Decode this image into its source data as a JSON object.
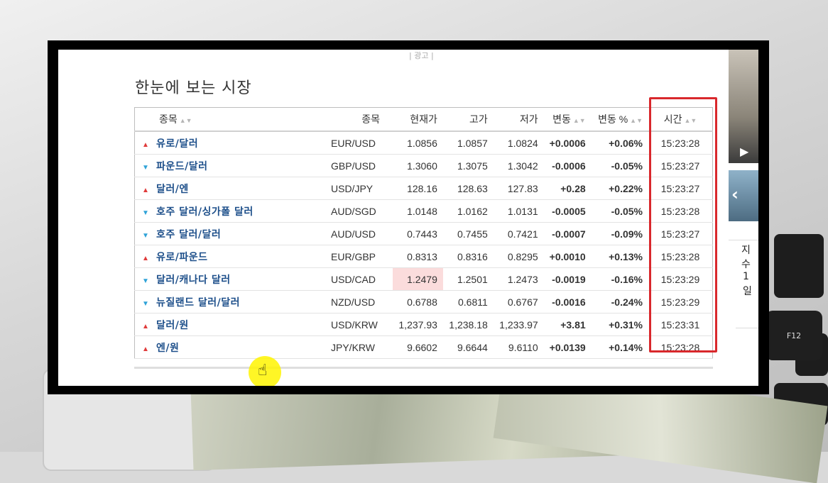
{
  "ad_label": "| 광고 |",
  "title": "한눈에 보는 시장",
  "table": {
    "headers": {
      "name": "종목",
      "symbol": "종목",
      "current": "현재가",
      "high": "고가",
      "low": "저가",
      "change": "변동",
      "change_pct": "변동 %",
      "time": "시간"
    },
    "rows": [
      {
        "dir": "up",
        "name": "유로/달러",
        "symbol": "EUR/USD",
        "current": "1.0856",
        "high": "1.0857",
        "low": "1.0824",
        "change": "+0.0006",
        "change_pct": "+0.06%",
        "time": "15:23:28"
      },
      {
        "dir": "down",
        "name": "파운드/달러",
        "symbol": "GBP/USD",
        "current": "1.3060",
        "high": "1.3075",
        "low": "1.3042",
        "change": "-0.0006",
        "change_pct": "-0.05%",
        "time": "15:23:27"
      },
      {
        "dir": "up",
        "name": "달러/엔",
        "symbol": "USD/JPY",
        "current": "128.16",
        "high": "128.63",
        "low": "127.83",
        "change": "+0.28",
        "change_pct": "+0.22%",
        "time": "15:23:27"
      },
      {
        "dir": "down",
        "name": "호주 달러/싱가폴 달러",
        "symbol": "AUD/SGD",
        "current": "1.0148",
        "high": "1.0162",
        "low": "1.0131",
        "change": "-0.0005",
        "change_pct": "-0.05%",
        "time": "15:23:28"
      },
      {
        "dir": "down",
        "name": "호주 달러/달러",
        "symbol": "AUD/USD",
        "current": "0.7443",
        "high": "0.7455",
        "low": "0.7421",
        "change": "-0.0007",
        "change_pct": "-0.09%",
        "time": "15:23:27"
      },
      {
        "dir": "up",
        "name": "유로/파운드",
        "symbol": "EUR/GBP",
        "current": "0.8313",
        "high": "0.8316",
        "low": "0.8295",
        "change": "+0.0010",
        "change_pct": "+0.13%",
        "time": "15:23:28"
      },
      {
        "dir": "down",
        "name": "달러/캐나다 달러",
        "symbol": "USD/CAD",
        "current": "1.2479",
        "high": "1.2501",
        "low": "1.2473",
        "change": "-0.0019",
        "change_pct": "-0.16%",
        "time": "15:23:29"
      },
      {
        "dir": "down",
        "name": "뉴질랜드 달러/달러",
        "symbol": "NZD/USD",
        "current": "0.6788",
        "high": "0.6811",
        "low": "0.6767",
        "change": "-0.0016",
        "change_pct": "-0.24%",
        "time": "15:23:29"
      },
      {
        "dir": "up",
        "name": "달러/원",
        "symbol": "USD/KRW",
        "current": "1,237.93",
        "high": "1,238.18",
        "low": "1,233.97",
        "change": "+3.81",
        "change_pct": "+0.31%",
        "time": "15:23:31"
      },
      {
        "dir": "up",
        "name": "엔/원",
        "symbol": "JPY/KRW",
        "current": "9.6602",
        "high": "9.6644",
        "low": "9.6110",
        "change": "+0.0139",
        "change_pct": "+0.14%",
        "time": "15:23:28"
      }
    ]
  },
  "side": {
    "tab_label": "지수",
    "num": "1",
    "unit": "일"
  },
  "keyboard_label": "F12",
  "colors": {
    "up": "#e03b3b",
    "down": "#2fa3d8",
    "positive_text": "#d3262d",
    "negative_text": "#1a93b4",
    "highlight": "#d9282c"
  }
}
